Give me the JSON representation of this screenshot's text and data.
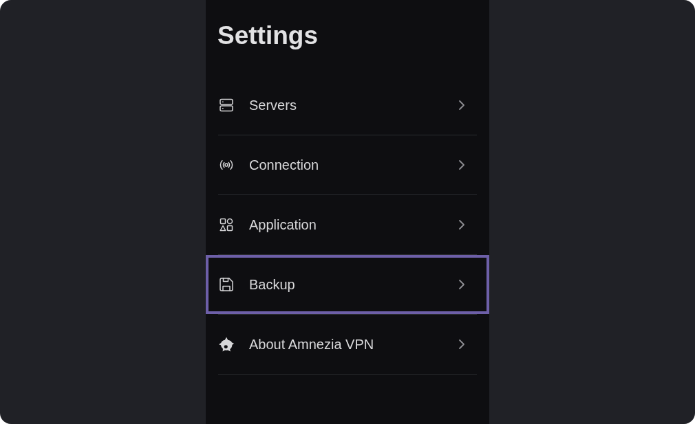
{
  "title": "Settings",
  "items": [
    {
      "label": "Servers",
      "focused": false
    },
    {
      "label": "Connection",
      "focused": false
    },
    {
      "label": "Application",
      "focused": false
    },
    {
      "label": "Backup",
      "focused": true
    },
    {
      "label": "About Amnezia VPN",
      "focused": false
    }
  ]
}
